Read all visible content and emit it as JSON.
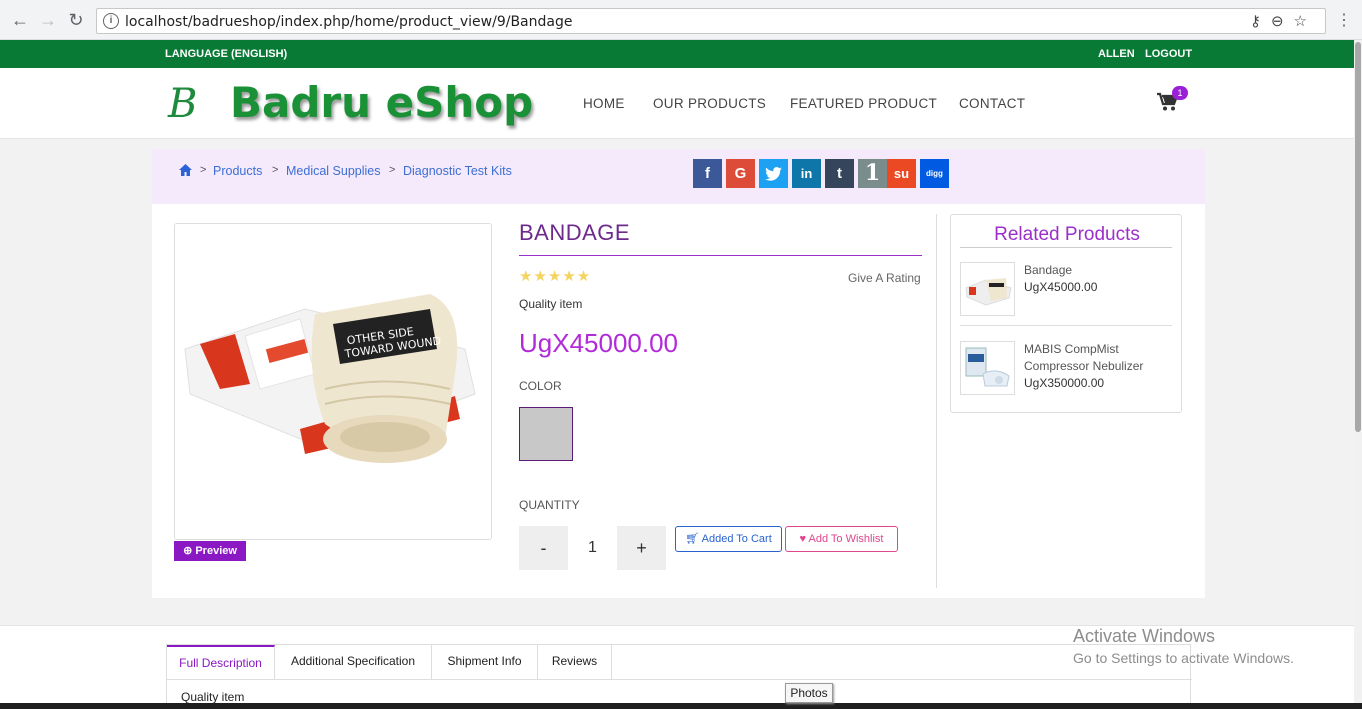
{
  "browser": {
    "url": "localhost/badrueshop/index.php/home/product_view/9/Bandage",
    "info_icon": "info-icon",
    "right_icons": "⚷ ⊖ ☆"
  },
  "topbar": {
    "language": "LANGUAGE (ENGLISH)",
    "user": "ALLEN",
    "logout": "LOGOUT"
  },
  "header": {
    "logo_initial": "B",
    "logo_text": "Badru eShop",
    "nav": [
      "HOME",
      "OUR PRODUCTS",
      "FEATURED PRODUCT",
      "CONTACT"
    ],
    "cart_count": "1"
  },
  "breadcrumb": {
    "items": [
      "Products",
      "Medical Supplies",
      "Diagnostic Test Kits"
    ],
    "separator": ">"
  },
  "share": [
    {
      "name": "facebook",
      "glyph": "f",
      "color": "#3b5998"
    },
    {
      "name": "google",
      "glyph": "G",
      "color": "#dd4b39"
    },
    {
      "name": "twitter",
      "glyph": "t",
      "color": "#1da1f2"
    },
    {
      "name": "linkedin",
      "glyph": "in",
      "color": "#0e76a8"
    },
    {
      "name": "tumblr",
      "glyph": "t",
      "color": "#35465c"
    },
    {
      "name": "one",
      "glyph": "1",
      "color": "#7a8c8c"
    },
    {
      "name": "stumbleupon",
      "glyph": "su",
      "color": "#eb4924"
    },
    {
      "name": "digg",
      "glyph": "digg",
      "color": "#005be2"
    }
  ],
  "product": {
    "title": "BANDAGE",
    "stars": "★★★★★",
    "give_rating": "Give A Rating",
    "quality": "Quality item",
    "price": "UgX45000.00",
    "color_label": "COLOR",
    "quantity_label": "QUANTITY",
    "qty_minus": "-",
    "qty_value": "1",
    "qty_plus": "+",
    "added_to_cart": "Added To Cart",
    "add_to_wishlist": "Add To Wishlist",
    "preview": "Preview"
  },
  "related": {
    "title": "Related Products",
    "items": [
      {
        "name": "Bandage",
        "price": "UgX45000.00"
      },
      {
        "name": "MABIS CompMist Compressor Nebulizer",
        "price": "UgX350000.00"
      }
    ]
  },
  "tabs": {
    "items": [
      "Full Description",
      "Additional Specification",
      "Shipment Info",
      "Reviews"
    ],
    "description": "Quality item"
  },
  "os": {
    "watermark_1": "Activate Windows",
    "watermark_2": "Go to Settings to activate Windows.",
    "tooltip": "Photos"
  }
}
